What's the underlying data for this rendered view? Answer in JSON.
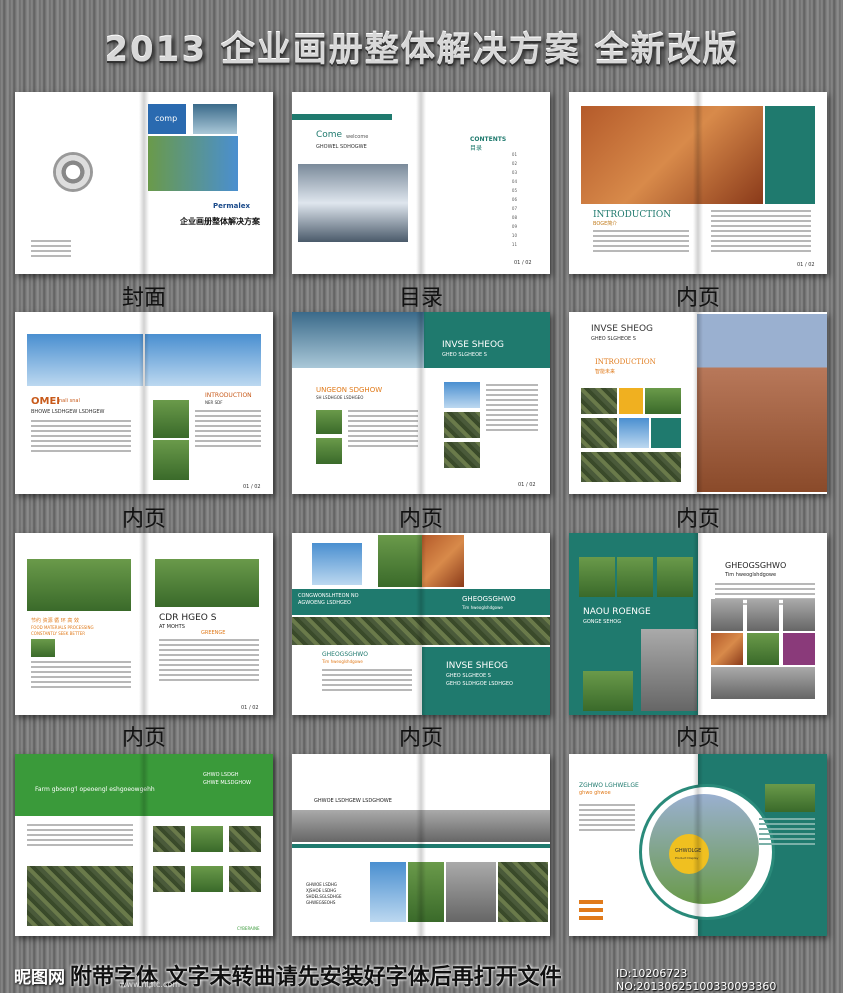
{
  "title": "2013 企业画册整体解决方案  全新改版",
  "captions": [
    "封面",
    "目录",
    "内页",
    "内页",
    "内页",
    "内页",
    "内页",
    "内页",
    "内页"
  ],
  "cover": {
    "logo_text": "comp",
    "brand": "Permalex",
    "heading": "企业画册整体解决方案"
  },
  "toc": {
    "come": "Come",
    "come_sub": "welcome",
    "sub": "GHOWEL SDHOGWE",
    "contents": "CONTENTS",
    "contents_cn": "目录",
    "items": [
      "01",
      "02",
      "03",
      "04",
      "05",
      "06",
      "07",
      "08",
      "09",
      "10",
      "11"
    ],
    "page": "01 / 02"
  },
  "intro1": {
    "heading": "INTRODUCTION",
    "sub": "BOGE简介",
    "page": "01 / 02"
  },
  "page4": {
    "omei": "OMEI",
    "omei_sub": "nali snal",
    "bhowe": "BHOWE LSDHGEW LSDHGEW",
    "intro": "INTRODUCTION",
    "intro_sub": "NER SDF",
    "page": "01 / 02"
  },
  "page5": {
    "h1": "INVSE SHEOG",
    "h1_sub": "GHEO SLGHEOE S",
    "h2": "UNGEON SDGHOW",
    "h2_sub": "SH LSDHGOE LSDHGEO",
    "page": "01 / 02"
  },
  "page6": {
    "h1": "INVSE SHEOG",
    "h1_sub": "GHEO SLGHEOE S",
    "intro": "INTRODUCTION",
    "intro_sub": "智能未来"
  },
  "page7": {
    "h1": "CDR HGEO S",
    "h1_sub": "AT MOHTS",
    "h1_sub2": "GREENGE",
    "cn": "节约 资源  循 环 高 效",
    "en": "FOOD MATERIALS PROCESSING",
    "en2": "CONSTANTLY SEEK BETTER",
    "page": "01 / 02"
  },
  "page8": {
    "c1": "CONGWONSLHTEON NO",
    "c1b": "AGWOENG LSDHGEO",
    "c2": "GHEOGSGHWO",
    "c2_sub": "Tim hweoglshdgowe",
    "c3": "GHEOGSGHWO",
    "c3_sub": "Tim hweoglshdgowe",
    "h1": "INVSE SHEOG",
    "h1_sub": "GHEO SLGHEOE S",
    "h1_sub2": "GEHO SLDHGOE LSDHGEO"
  },
  "page9": {
    "h1": "NAOU ROENGE",
    "h1_sub": "GONGE SEHOG",
    "h2": "GHEOGSGHWO",
    "h2_sub": "Tim hweoglshdgowe"
  },
  "page10": {
    "map_text": "Farm gboeng'l opeoengl eshgoeowgehh",
    "h1": "GHWO LSDGH",
    "h1b": "GHWE MLSDGHOW",
    "footer": "CYBERAINE"
  },
  "page11": {
    "h1": "GHWOE LSDHGEW LSDGHOWE",
    "h2": "GHWOE LSDHG",
    "h2b": "XJSHOE LSDHG",
    "h2c": "SHDELSGLSDHGE",
    "h2d": "GHWEGSEOHS"
  },
  "page12": {
    "h1": "ZGHWO LGHWELGE",
    "h1_sub": "ghwo ghwoe",
    "badge": "GHWOLGE",
    "badge_sub": "Product Display"
  },
  "watermark": {
    "site": "昵图网",
    "notice": "附带字体 文字未转曲请先安装好字体后再打开文件",
    "url": "www.nipic.com",
    "id": "ID:10206723 NO:20130625100330093360"
  },
  "colors": {
    "teal": "#1f7a6e",
    "green": "#3a9a3a",
    "orange": "#e07a1a"
  }
}
